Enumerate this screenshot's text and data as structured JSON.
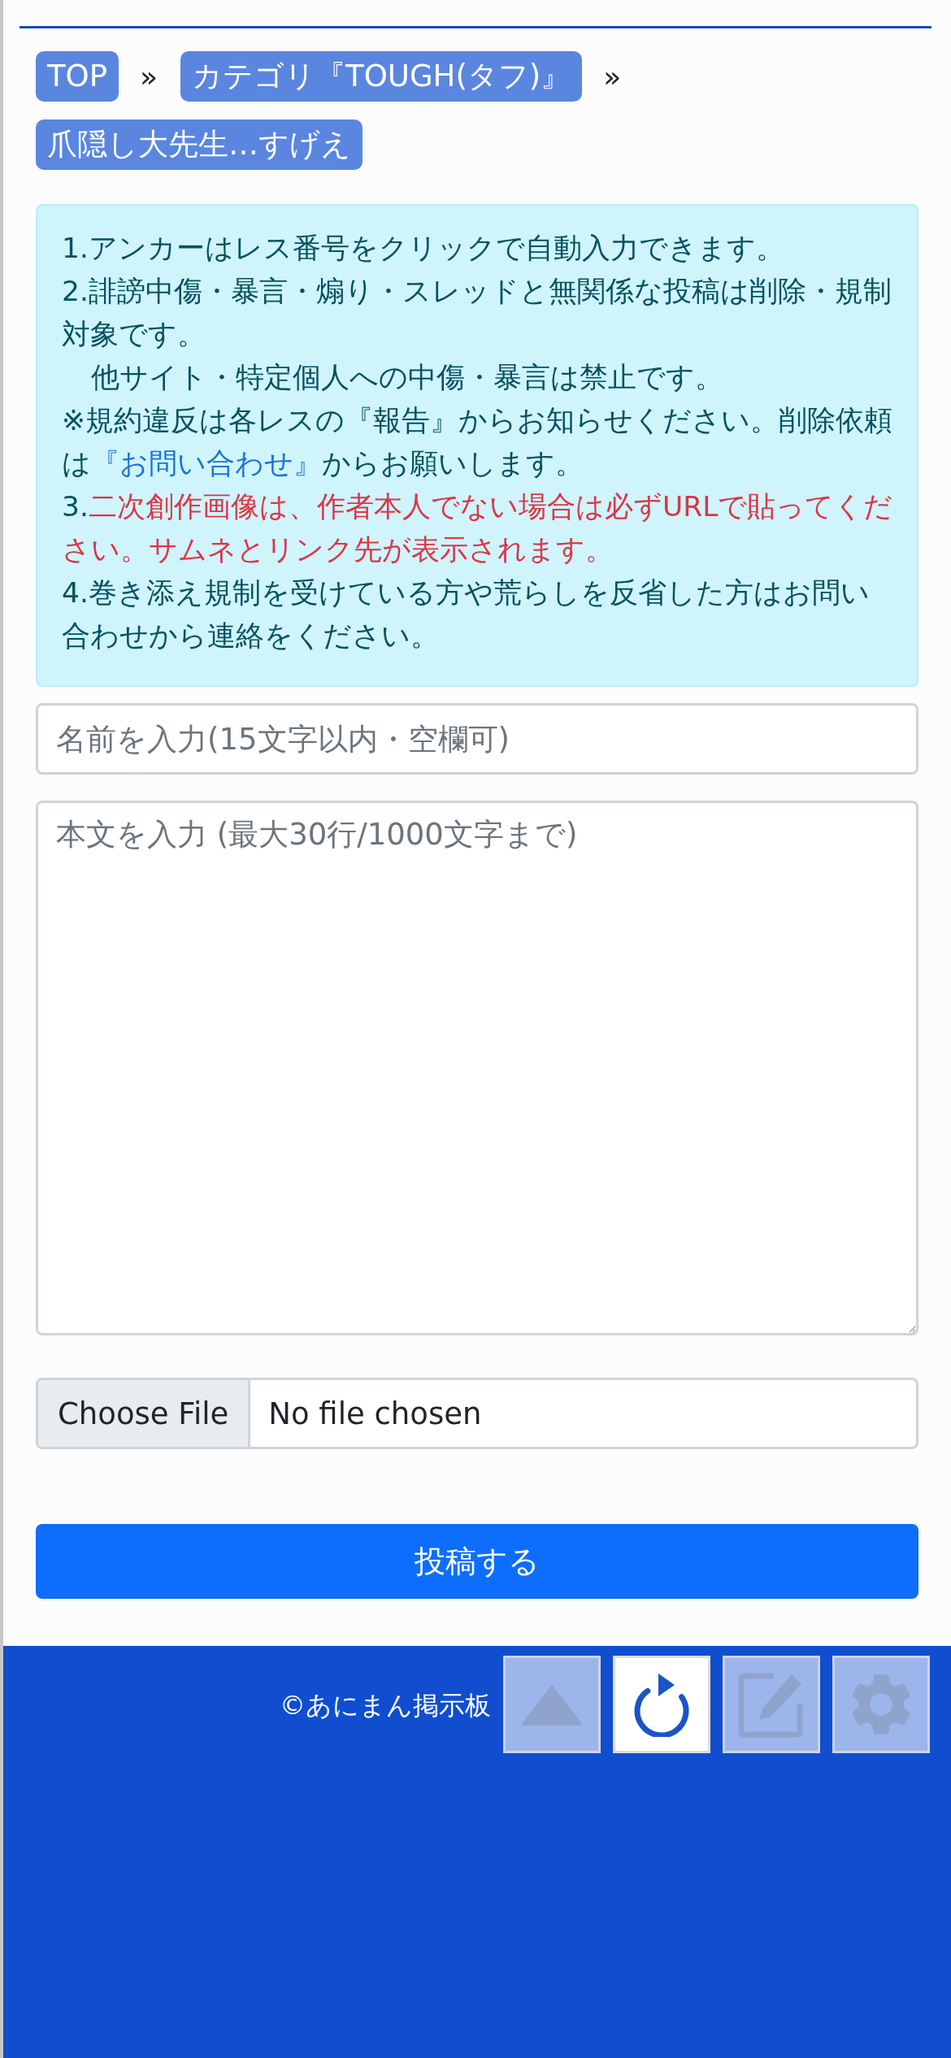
{
  "breadcrumbs": [
    {
      "label": "TOP"
    },
    {
      "label": "カテゴリ『TOUGH(タフ)』"
    },
    {
      "label": "爪隠し大先生…すげえ"
    }
  ],
  "breadcrumb_separator": "»",
  "notice": [
    {
      "indent": false,
      "segments": [
        {
          "kind": "text",
          "text": "1.アンカーはレス番号をクリックで自動入力できます。"
        }
      ]
    },
    {
      "indent": false,
      "segments": [
        {
          "kind": "text",
          "text": "2.誹謗中傷・暴言・煽り・スレッドと無関係な投稿は削除・規制対象です。"
        }
      ]
    },
    {
      "indent": true,
      "segments": [
        {
          "kind": "text",
          "text": "他サイト・特定個人への中傷・暴言は禁止です。"
        }
      ]
    },
    {
      "indent": false,
      "segments": [
        {
          "kind": "text",
          "text": "※規約違反は各レスの『報告』からお知らせください。削除依頼は"
        },
        {
          "kind": "link",
          "text": "『お問い合わせ』"
        },
        {
          "kind": "text",
          "text": "からお願いします。"
        }
      ]
    },
    {
      "indent": false,
      "segments": [
        {
          "kind": "text",
          "text": "3."
        },
        {
          "kind": "warning",
          "text": "二次創作画像は、作者本人でない場合は必ずURLで貼ってください。サムネとリンク先が表示されます。"
        }
      ]
    },
    {
      "indent": false,
      "segments": [
        {
          "kind": "text",
          "text": "4.巻き添え規制を受けている方や荒らしを反省した方はお問い合わせから連絡をください。"
        }
      ]
    }
  ],
  "name_field": {
    "placeholder": "名前を入力(15文字以内・空欄可)"
  },
  "body_field": {
    "placeholder": "本文を入力 (最大30行/1000文字まで)"
  },
  "file_input": {
    "button": "Choose File",
    "status": "No file chosen"
  },
  "submit_button": "投稿する",
  "footer": {
    "copyright": "©あにまん掲示板"
  },
  "floating_buttons": [
    {
      "kind": "top",
      "selected": false
    },
    {
      "kind": "reload",
      "selected": true
    },
    {
      "kind": "edit",
      "selected": false
    },
    {
      "kind": "settings",
      "selected": false
    }
  ]
}
